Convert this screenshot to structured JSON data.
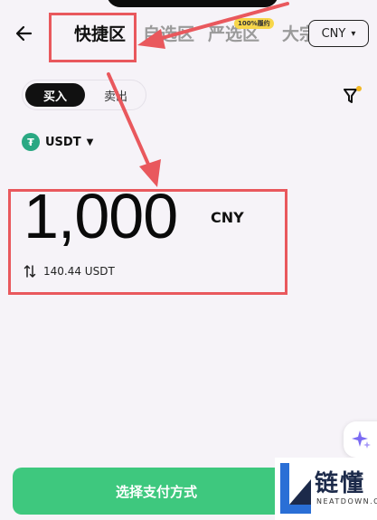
{
  "header": {
    "tabs": [
      {
        "label": "快捷区",
        "active": true
      },
      {
        "label": "自选区",
        "active": false
      },
      {
        "label": "严选区",
        "active": false,
        "badge": "100%履约"
      },
      {
        "label": "大宗",
        "active": false
      }
    ],
    "currency": "CNY"
  },
  "trade": {
    "buy_label": "买入",
    "sell_label": "卖出",
    "asset": "USDT",
    "asset_icon_glyph": "₮",
    "amount": "1,000",
    "amount_unit": "CNY",
    "converted": "140.44 USDT"
  },
  "cta_label": "选择支付方式",
  "watermark": {
    "text": "链懂",
    "sub": "NEATDOWN.COM"
  },
  "colors": {
    "accent_green": "#3ec87e",
    "annotation_red": "#e9585d",
    "badge_yellow": "#f7d64a",
    "tether_green": "#2aa883"
  }
}
